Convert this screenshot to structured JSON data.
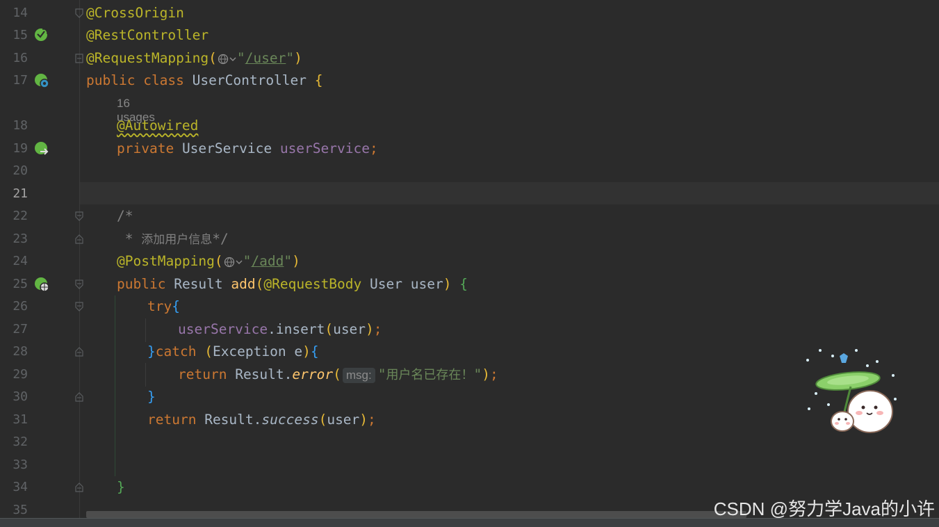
{
  "editor": {
    "active_line": "21",
    "line_numbers": [
      "14",
      "15",
      "16",
      "17",
      "18",
      "19",
      "20",
      "21",
      "22",
      "23",
      "24",
      "25",
      "26",
      "27",
      "28",
      "29",
      "30",
      "31",
      "32",
      "33",
      "34",
      "35"
    ],
    "code": {
      "l14": {
        "ann": "@CrossOrigin"
      },
      "l15": {
        "ann": "@RestController"
      },
      "l16": {
        "ann": "@RequestMapping",
        "open": "(",
        "q1": "\"",
        "path": "/user",
        "q2": "\"",
        "close": ")"
      },
      "l17": {
        "kw1": "public",
        "kw2": "class",
        "name": "UserController",
        "brace": "{"
      },
      "usages": "16 usages",
      "l18": {
        "ann": "@Autowired"
      },
      "l19": {
        "kw": "private",
        "type": "UserService",
        "field": "userService",
        "semi": ";"
      },
      "l22": {
        "text": "/*"
      },
      "l23": {
        "star": " * ",
        "cjk": "添加用户信息",
        "end": "*/"
      },
      "l24": {
        "ann": "@PostMapping",
        "open": "(",
        "q1": "\"",
        "path": "/add",
        "q2": "\"",
        "close": ")"
      },
      "l25": {
        "kw": "public",
        "type": "Result",
        "fn": "add",
        "open": "(",
        "ann": "@RequestBody",
        "ptype": "User",
        "pname": "user",
        "close": ")",
        "brace": "{"
      },
      "l26": {
        "kw": "try",
        "brace": "{"
      },
      "l27": {
        "field": "userService",
        "call": ".insert",
        "open": "(",
        "arg": "user",
        "close": ")",
        "semi": ";"
      },
      "l28": {
        "rbrace": "}",
        "kw": "catch",
        "open": "(",
        "type": "Exception",
        "var": "e",
        "close": ")",
        "lbrace": "{"
      },
      "l29": {
        "kw": "return",
        "cls": "Result.",
        "fn": "error",
        "open": "(",
        "hint": "msg:",
        "q1": "\"",
        "cjk": "用户名已存在！",
        "q2": "\"",
        "close": ")",
        "semi": ";"
      },
      "l30": {
        "brace": "}"
      },
      "l31": {
        "kw": "return",
        "cls": "Result.",
        "fn": "success",
        "open": "(",
        "arg": "user",
        "close": ")",
        "semi": ";"
      },
      "l34": {
        "brace": "}"
      }
    }
  },
  "gutter_icons": [
    "spring-bean-icon",
    "spring-bean-icon",
    "autowired-navigate-icon",
    "web-endpoint-icon"
  ],
  "watermark": "CSDN @努力学Java的小许",
  "colors": {
    "background": "#2b2b2b",
    "keyword": "#cc7832",
    "annotation": "#bbb529",
    "field": "#9876aa",
    "string": "#6a8759",
    "method": "#ffc66d",
    "comment": "#808080"
  }
}
